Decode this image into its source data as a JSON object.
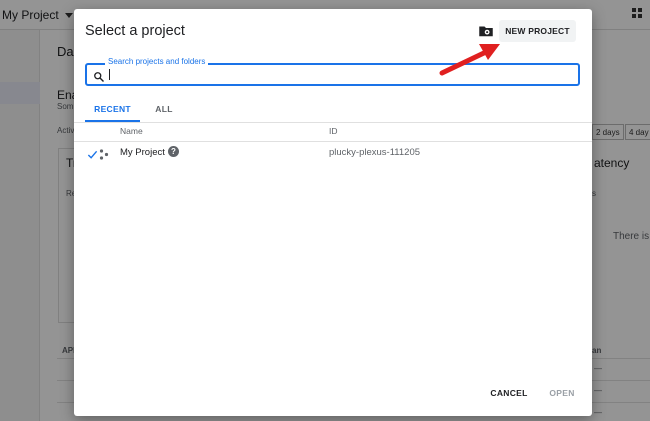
{
  "background": {
    "project_selector": "My Project",
    "page_title": "Das",
    "section_title": "Ena",
    "section_sub": "Som",
    "activity_label": "Activ",
    "card_title": "Tr",
    "card_text": "Re",
    "chips": [
      "2 days",
      "4 day"
    ],
    "right_title": "atency",
    "right_small": "s",
    "right_text": "There is",
    "table_header": "API",
    "table_right": "an",
    "table_dashes": [
      "—",
      "—",
      "—"
    ]
  },
  "dialog": {
    "title": "Select a project",
    "folder_icon": "folder-settings-icon",
    "new_project_label": "NEW PROJECT",
    "search": {
      "label": "Search projects and folders",
      "value": "",
      "icon": "search-icon"
    },
    "tabs": [
      {
        "label": "RECENT",
        "active": true
      },
      {
        "label": "ALL",
        "active": false
      }
    ],
    "columns": {
      "name": "Name",
      "id": "ID"
    },
    "rows": [
      {
        "name": "My Project",
        "id": "plucky-plexus-111205",
        "selected": true
      }
    ],
    "cancel_label": "CANCEL",
    "open_label": "OPEN"
  },
  "colors": {
    "accent": "#1a73e8",
    "annotation_arrow": "#e02020"
  }
}
